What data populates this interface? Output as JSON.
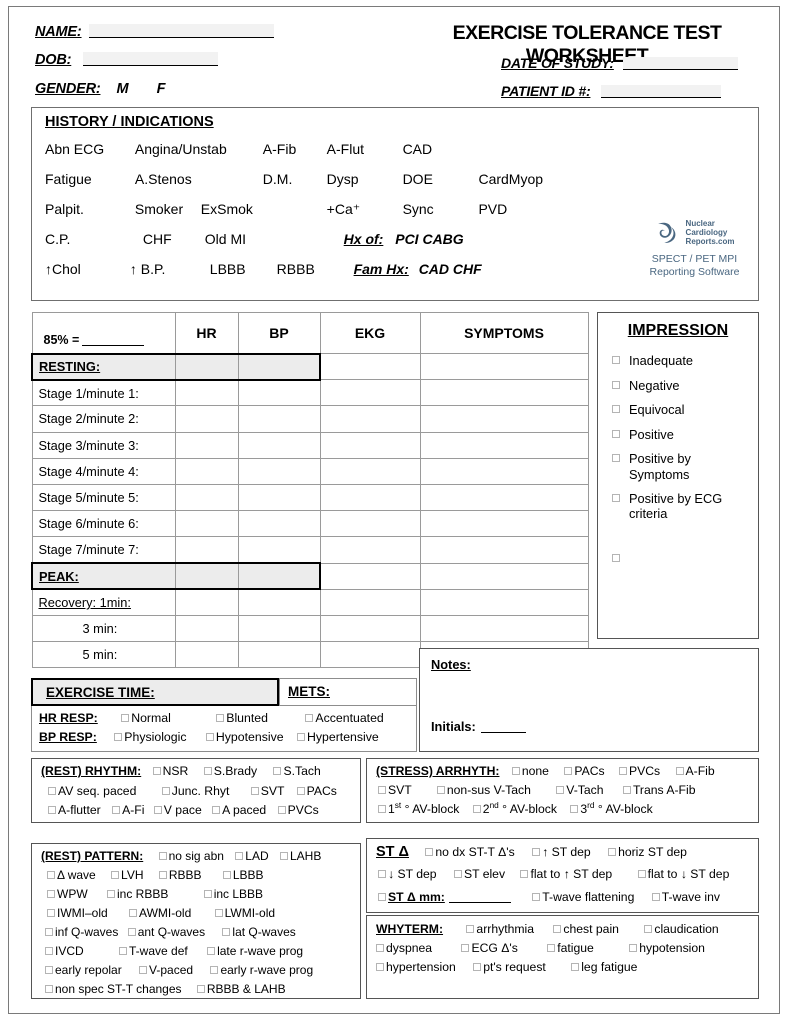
{
  "header": {
    "name_label": "NAME:",
    "dob_label": "DOB:",
    "gender_label": "GENDER:",
    "gender_male": "M",
    "gender_female": "F",
    "title": "EXERCISE TOLERANCE TEST WORKSHEET",
    "date_of_study_label": "DATE OF STUDY:",
    "patient_id_label": "PATIENT ID #:",
    "name_value": "",
    "dob_value": "",
    "date_of_study_value": "",
    "patient_id_value": ""
  },
  "history": {
    "title": "HISTORY / INDICATIONS",
    "rows": [
      [
        "Abn ECG",
        "Angina/Unstab",
        "A-Fib",
        "A-Flut",
        "CAD"
      ],
      [
        "Fatigue",
        "A.Stenos",
        "D.M.",
        "Dysp",
        "DOE",
        "CardMyop"
      ],
      [
        "Palpit.",
        "Smoker",
        "ExSmok",
        "+Ca⁺",
        "Sync",
        "PVD"
      ],
      [
        "C.P.",
        "CHF",
        "Old MI"
      ],
      [
        "↑Chol",
        "↑ B.P.",
        "LBBB",
        "RBBB"
      ]
    ],
    "hx_of_label": "Hx of:",
    "hx_of_items": "PCI  CABG",
    "fam_hx_label": "Fam Hx:",
    "fam_hx_items": "CAD  CHF",
    "logo": {
      "brand_line1": "Nuclear",
      "brand_line2": "Cardiology",
      "brand_line3": "Reports.com",
      "sub_line1": "SPECT / PET MPI",
      "sub_line2": "Reporting Software",
      "color": "#4a6781"
    }
  },
  "vitals_table": {
    "corner_label": "85% =",
    "columns": [
      "HR",
      "BP",
      "EKG",
      "SYMPTOMS"
    ],
    "rows": [
      {
        "label": "RESTING:",
        "emphasis": "thick",
        "hr": "",
        "bp": "",
        "ekg": "",
        "symptoms": ""
      },
      {
        "label": "Stage 1/minute 1:",
        "emphasis": "normal",
        "hr": "",
        "bp": "",
        "ekg": "",
        "symptoms": ""
      },
      {
        "label": "Stage 2/minute 2:",
        "emphasis": "normal",
        "hr": "",
        "bp": "",
        "ekg": "",
        "symptoms": ""
      },
      {
        "label": "Stage 3/minute 3:",
        "emphasis": "normal",
        "hr": "",
        "bp": "",
        "ekg": "",
        "symptoms": ""
      },
      {
        "label": "Stage 4/minute 4:",
        "emphasis": "normal",
        "hr": "",
        "bp": "",
        "ekg": "",
        "symptoms": ""
      },
      {
        "label": "Stage 5/minute 5:",
        "emphasis": "normal",
        "hr": "",
        "bp": "",
        "ekg": "",
        "symptoms": ""
      },
      {
        "label": "Stage 6/minute 6:",
        "emphasis": "normal",
        "hr": "",
        "bp": "",
        "ekg": "",
        "symptoms": ""
      },
      {
        "label": "Stage 7/minute 7:",
        "emphasis": "normal",
        "hr": "",
        "bp": "",
        "ekg": "",
        "symptoms": ""
      },
      {
        "label": "PEAK:",
        "emphasis": "thick",
        "hr": "",
        "bp": "",
        "ekg": "",
        "symptoms": ""
      },
      {
        "label": "Recovery:  1min:",
        "emphasis": "recovery",
        "hr": "",
        "bp": "",
        "ekg": "",
        "symptoms": ""
      },
      {
        "label": "3 min:",
        "emphasis": "indent",
        "hr": "",
        "bp": "",
        "ekg": "",
        "symptoms": ""
      },
      {
        "label": "5 min:",
        "emphasis": "indent",
        "hr": "",
        "bp": "",
        "ekg": "",
        "symptoms": ""
      }
    ]
  },
  "impression": {
    "title": "IMPRESSION",
    "options": [
      "Inadequate",
      "Negative",
      "Equivocal",
      "Positive",
      "Positive by Symptoms",
      "Positive by ECG criteria",
      ""
    ]
  },
  "exercise": {
    "exercise_time_label": "EXERCISE TIME:",
    "exercise_time_value": "",
    "mets_label": "METS:",
    "mets_value": "",
    "hr_resp_label": "HR RESP:",
    "hr_resp_options": [
      "Normal",
      "Blunted",
      "Accentuated"
    ],
    "bp_resp_label": "BP RESP:",
    "bp_resp_options": [
      "Physiologic",
      "Hypotensive",
      "Hypertensive"
    ]
  },
  "notes": {
    "notes_label": "Notes:",
    "notes_value": "",
    "initials_label": "Initials:",
    "initials_value": ""
  },
  "rest_rhythm": {
    "title": "(REST) RHYTHM:",
    "line1": [
      "NSR",
      "S.Brady",
      "S.Tach"
    ],
    "line2": [
      "AV seq. paced",
      "Junc. Rhyt",
      "SVT",
      "PACs"
    ],
    "line3": [
      "A-flutter",
      "A-Fi",
      "V pace",
      "A paced",
      "PVCs"
    ]
  },
  "stress_arrhyth": {
    "title": "(STRESS) ARRHYTH:",
    "line1": [
      "none",
      "PACs",
      "PVCs",
      "A-Fib"
    ],
    "line2": [
      "SVT",
      "non-sus V-Tach",
      "V-Tach",
      "Trans A-Fib"
    ],
    "line3_html": [
      "1<sup>st</sup> ° AV-block",
      "2<sup>nd</sup> ° AV-block",
      "3<sup>rd</sup> ° AV-block"
    ]
  },
  "rest_pattern": {
    "title": "(REST) PATTERN:",
    "line1": [
      "no sig abn",
      "LAD",
      "LAHB"
    ],
    "line2": [
      "Δ wave",
      "LVH",
      "RBBB",
      "LBBB"
    ],
    "line3": [
      "WPW",
      "inc RBBB",
      "inc LBBB"
    ],
    "line4": [
      "IWMI–old",
      "AWMI-old",
      "LWMI-old"
    ],
    "line5": [
      "inf Q-waves",
      "ant Q-waves",
      "lat Q-waves"
    ],
    "line6": [
      "IVCD",
      "T-wave def",
      "late r-wave prog"
    ],
    "line7": [
      "early repolar",
      "V-paced",
      "early r-wave prog"
    ],
    "line8": [
      "non spec ST-T changes",
      "RBBB & LAHB"
    ]
  },
  "st_delta": {
    "title": "ST Δ",
    "line1": [
      "no dx ST-T Δ's",
      "↑ ST dep",
      "horiz ST dep"
    ],
    "line2": [
      "↓ ST dep",
      "ST elev",
      "flat to ↑ ST dep",
      "flat to ↓ ST dep"
    ],
    "mm_label": "ST Δ mm:",
    "mm_value": "",
    "line3_rest": [
      "T-wave flattening",
      "T-wave inv"
    ]
  },
  "whyterm": {
    "title": "WHYTERM:",
    "line1": [
      "arrhythmia",
      "chest pain",
      "claudication"
    ],
    "line2": [
      "dyspnea",
      "ECG Δ's",
      "fatigue",
      "hypotension"
    ],
    "line3": [
      "hypertension",
      "pt's request",
      "leg fatigue"
    ]
  }
}
